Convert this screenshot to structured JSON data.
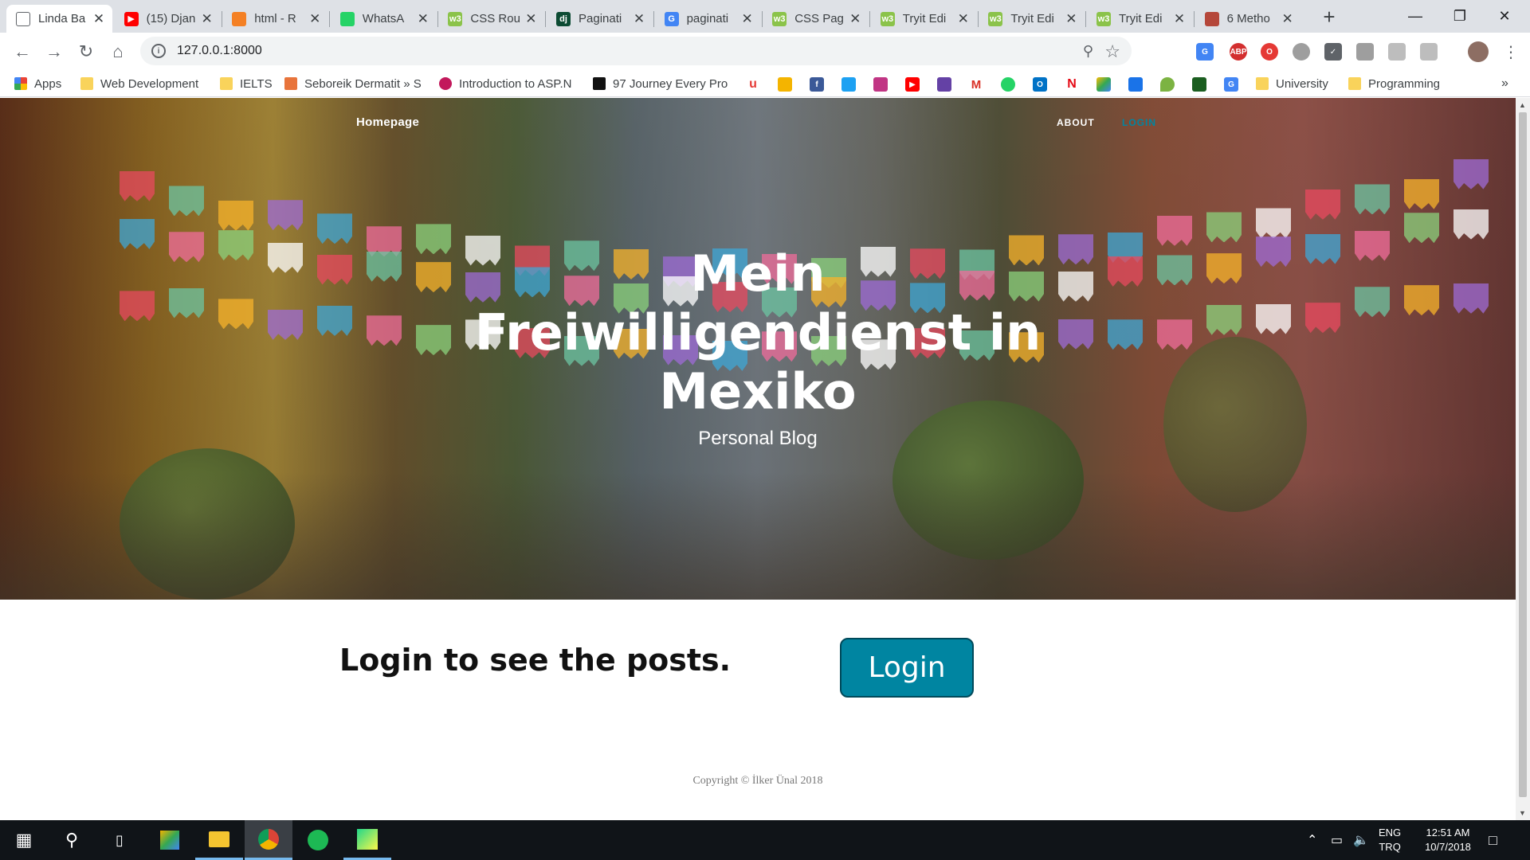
{
  "browser": {
    "tabs": [
      {
        "title": "Linda Ba",
        "favicon": "page-icon",
        "color": "#ffffff",
        "active": true
      },
      {
        "title": "(15) Djan",
        "favicon": "youtube-icon",
        "color": "#ff0000"
      },
      {
        "title": "html - R",
        "favicon": "stackoverflow-icon",
        "color": "#f48024"
      },
      {
        "title": "WhatsA",
        "favicon": "whatsapp-icon",
        "color": "#25d366"
      },
      {
        "title": "CSS Rou",
        "favicon": "w3schools-icon",
        "color": "#8bc34a"
      },
      {
        "title": "Paginati",
        "favicon": "django-icon",
        "color": "#0c4b33"
      },
      {
        "title": "paginati",
        "favicon": "google-icon",
        "color": "#4285f4"
      },
      {
        "title": "CSS Pag",
        "favicon": "w3schools-icon",
        "color": "#8bc34a"
      },
      {
        "title": "Tryit Edi",
        "favicon": "w3schools-icon",
        "color": "#8bc34a"
      },
      {
        "title": "Tryit Edi",
        "favicon": "w3schools-icon",
        "color": "#8bc34a"
      },
      {
        "title": "Tryit Edi",
        "favicon": "w3schools-icon",
        "color": "#8bc34a"
      },
      {
        "title": "6 Metho",
        "favicon": "grid-icon",
        "color": "#b5473a"
      }
    ],
    "url": "127.0.0.1:8000",
    "bookmarks": {
      "apps": "Apps",
      "web_dev": "Web Development",
      "ielts": "IELTS",
      "seboreik": "Seboreik Dermatit » S",
      "asp": "Introduction to ASP.N",
      "journey": "97 Journey Every Pro",
      "university": "University",
      "programming": "Programming"
    }
  },
  "page": {
    "nav": {
      "home": "Homepage",
      "about": "ABOUT",
      "login": "LOGIN"
    },
    "hero": {
      "title_lines": [
        "Mein",
        "Freiwilligendienst in",
        "Mexiko"
      ],
      "subtitle": "Personal Blog"
    },
    "login_prompt": "Login to see the posts.",
    "login_button": "Login",
    "copyright": "Copyright © İlker Ünal 2018"
  },
  "taskbar": {
    "lang_top": "ENG",
    "lang_bottom": "TRQ",
    "time": "12:51 AM",
    "date": "10/7/2018"
  },
  "colors": {
    "accent": "#0085a1",
    "taskbar": "#101418"
  }
}
